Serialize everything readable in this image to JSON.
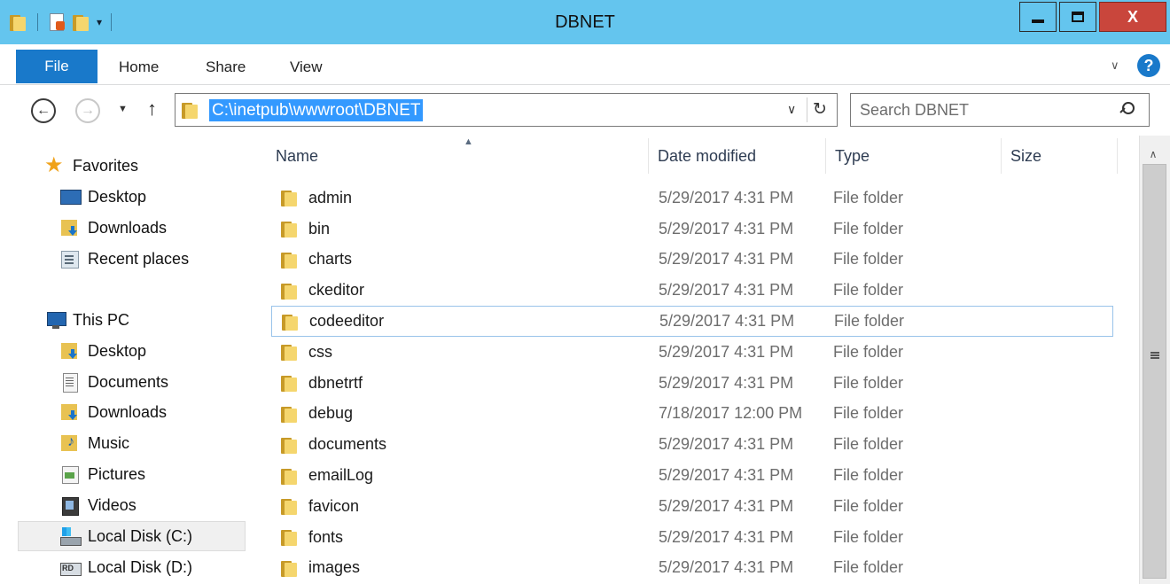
{
  "window": {
    "title": "DBNET",
    "close_label": "X"
  },
  "ribbon": {
    "tabs": [
      "File",
      "Home",
      "Share",
      "View"
    ],
    "help_label": "?"
  },
  "address_bar": {
    "path": "C:\\inetpub\\wwwroot\\DBNET",
    "search_placeholder": "Search DBNET"
  },
  "nav_pane": {
    "favorites": {
      "label": "Favorites",
      "items": [
        "Desktop",
        "Downloads",
        "Recent places"
      ]
    },
    "this_pc": {
      "label": "This PC",
      "items": [
        "Desktop",
        "Documents",
        "Downloads",
        "Music",
        "Pictures",
        "Videos",
        "Local Disk (C:)",
        "Local Disk (D:)"
      ]
    },
    "selected": "Local Disk (C:)"
  },
  "columns": {
    "name": "Name",
    "date_modified": "Date modified",
    "type": "Type",
    "size": "Size"
  },
  "files": [
    {
      "name": "admin",
      "date": "5/29/2017 4:31 PM",
      "type": "File folder"
    },
    {
      "name": "bin",
      "date": "5/29/2017 4:31 PM",
      "type": "File folder"
    },
    {
      "name": "charts",
      "date": "5/29/2017 4:31 PM",
      "type": "File folder"
    },
    {
      "name": "ckeditor",
      "date": "5/29/2017 4:31 PM",
      "type": "File folder"
    },
    {
      "name": "codeeditor",
      "date": "5/29/2017 4:31 PM",
      "type": "File folder"
    },
    {
      "name": "css",
      "date": "5/29/2017 4:31 PM",
      "type": "File folder"
    },
    {
      "name": "dbnetrtf",
      "date": "5/29/2017 4:31 PM",
      "type": "File folder"
    },
    {
      "name": "debug",
      "date": "7/18/2017 12:00 PM",
      "type": "File folder"
    },
    {
      "name": "documents",
      "date": "5/29/2017 4:31 PM",
      "type": "File folder"
    },
    {
      "name": "emailLog",
      "date": "5/29/2017 4:31 PM",
      "type": "File folder"
    },
    {
      "name": "favicon",
      "date": "5/29/2017 4:31 PM",
      "type": "File folder"
    },
    {
      "name": "fonts",
      "date": "5/29/2017 4:31 PM",
      "type": "File folder"
    },
    {
      "name": "images",
      "date": "5/29/2017 4:31 PM",
      "type": "File folder"
    }
  ],
  "hovered_file": "codeeditor",
  "icons": {
    "favorites": "star-icon",
    "folder": "folder-icon",
    "search": "search-icon",
    "refresh": "refresh-icon"
  },
  "colors": {
    "titlebar": "#64c5ee",
    "file_tab": "#1979ca",
    "close_button": "#c9463c",
    "selection": "#3399ff"
  }
}
